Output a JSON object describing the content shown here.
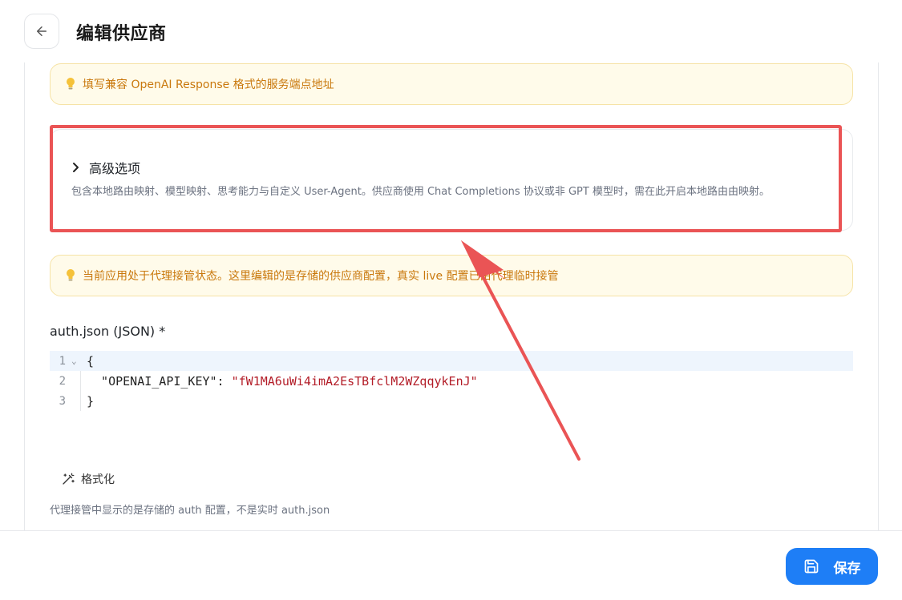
{
  "header": {
    "title": "编辑供应商",
    "back_icon": "arrow-left-icon"
  },
  "notices": {
    "endpoint_hint": "填写兼容 OpenAI Response 格式的服务端点地址",
    "proxy_status": "当前应用处于代理接管状态。这里编辑的是存储的供应商配置，真实 live 配置已由代理临时接管"
  },
  "advanced": {
    "title": "高级选项",
    "description": "包含本地路由映射、模型映射、思考能力与自定义 User-Agent。供应商使用 Chat Completions 协议或非 GPT 模型时，需在此开启本地路由由映射。",
    "expanded": false
  },
  "json_editor": {
    "label": "auth.json (JSON) *",
    "line_numbers": [
      "1",
      "2",
      "3"
    ],
    "line1": "{",
    "line2_key": "  \"OPENAI_API_KEY\": ",
    "line2_value": "\"fW1MA6uWi4imA2EsTBfclM2WZqqykEnJ\"",
    "line3": "}"
  },
  "format_button": {
    "label": "格式化",
    "icon": "magic-wand-icon"
  },
  "hint": "代理接管中显示的是存储的 auth 配置，不是实时 auth.json",
  "footer": {
    "save_label": "保存",
    "save_icon": "floppy-disk-icon"
  },
  "colors": {
    "accent": "#1e7ef6",
    "notice_text": "#c9780c",
    "annotation_red": "#ea5455"
  }
}
